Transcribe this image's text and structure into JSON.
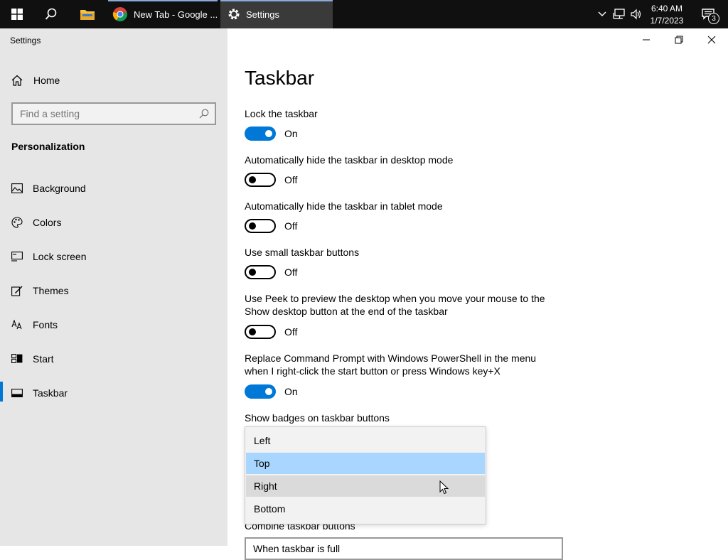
{
  "taskbar": {
    "tasks": [
      {
        "label": "New Tab - Google ..."
      },
      {
        "label": "Settings"
      }
    ],
    "clock": {
      "time": "6:40 AM",
      "date": "1/7/2023"
    },
    "notification_count": "3"
  },
  "window": {
    "app_title": "Settings"
  },
  "sidebar": {
    "home_label": "Home",
    "search_placeholder": "Find a setting",
    "section_title": "Personalization",
    "items": [
      {
        "label": "Background",
        "icon": "picture-icon"
      },
      {
        "label": "Colors",
        "icon": "palette-icon"
      },
      {
        "label": "Lock screen",
        "icon": "lock-screen-icon"
      },
      {
        "label": "Themes",
        "icon": "brush-icon"
      },
      {
        "label": "Fonts",
        "icon": "font-icon"
      },
      {
        "label": "Start",
        "icon": "start-icon"
      },
      {
        "label": "Taskbar",
        "icon": "taskbar-icon",
        "active": true
      }
    ]
  },
  "main": {
    "title": "Taskbar",
    "settings": [
      {
        "label": "Lock the taskbar",
        "state": "On"
      },
      {
        "label": "Automatically hide the taskbar in desktop mode",
        "state": "Off"
      },
      {
        "label": "Automatically hide the taskbar in tablet mode",
        "state": "Off"
      },
      {
        "label": "Use small taskbar buttons",
        "state": "Off"
      },
      {
        "label": "Use Peek to preview the desktop when you move your mouse to the Show desktop button at the end of the taskbar",
        "state": "Off"
      },
      {
        "label": "Replace Command Prompt with Windows PowerShell in the menu when I right-click the start button or press Windows key+X",
        "state": "On"
      }
    ],
    "badges_label": "Show badges on taskbar buttons",
    "location_dropdown": {
      "options": [
        "Left",
        "Top",
        "Right",
        "Bottom"
      ],
      "selected": "Top",
      "hovered": "Right"
    },
    "combine_label": "Combine taskbar buttons",
    "combine_value": "When taskbar is full"
  },
  "colors": {
    "accent": "#0078d7",
    "selected_option": "#a8d6ff",
    "sidebar_bg": "#e6e6e6",
    "taskbar_bg": "#101010"
  }
}
